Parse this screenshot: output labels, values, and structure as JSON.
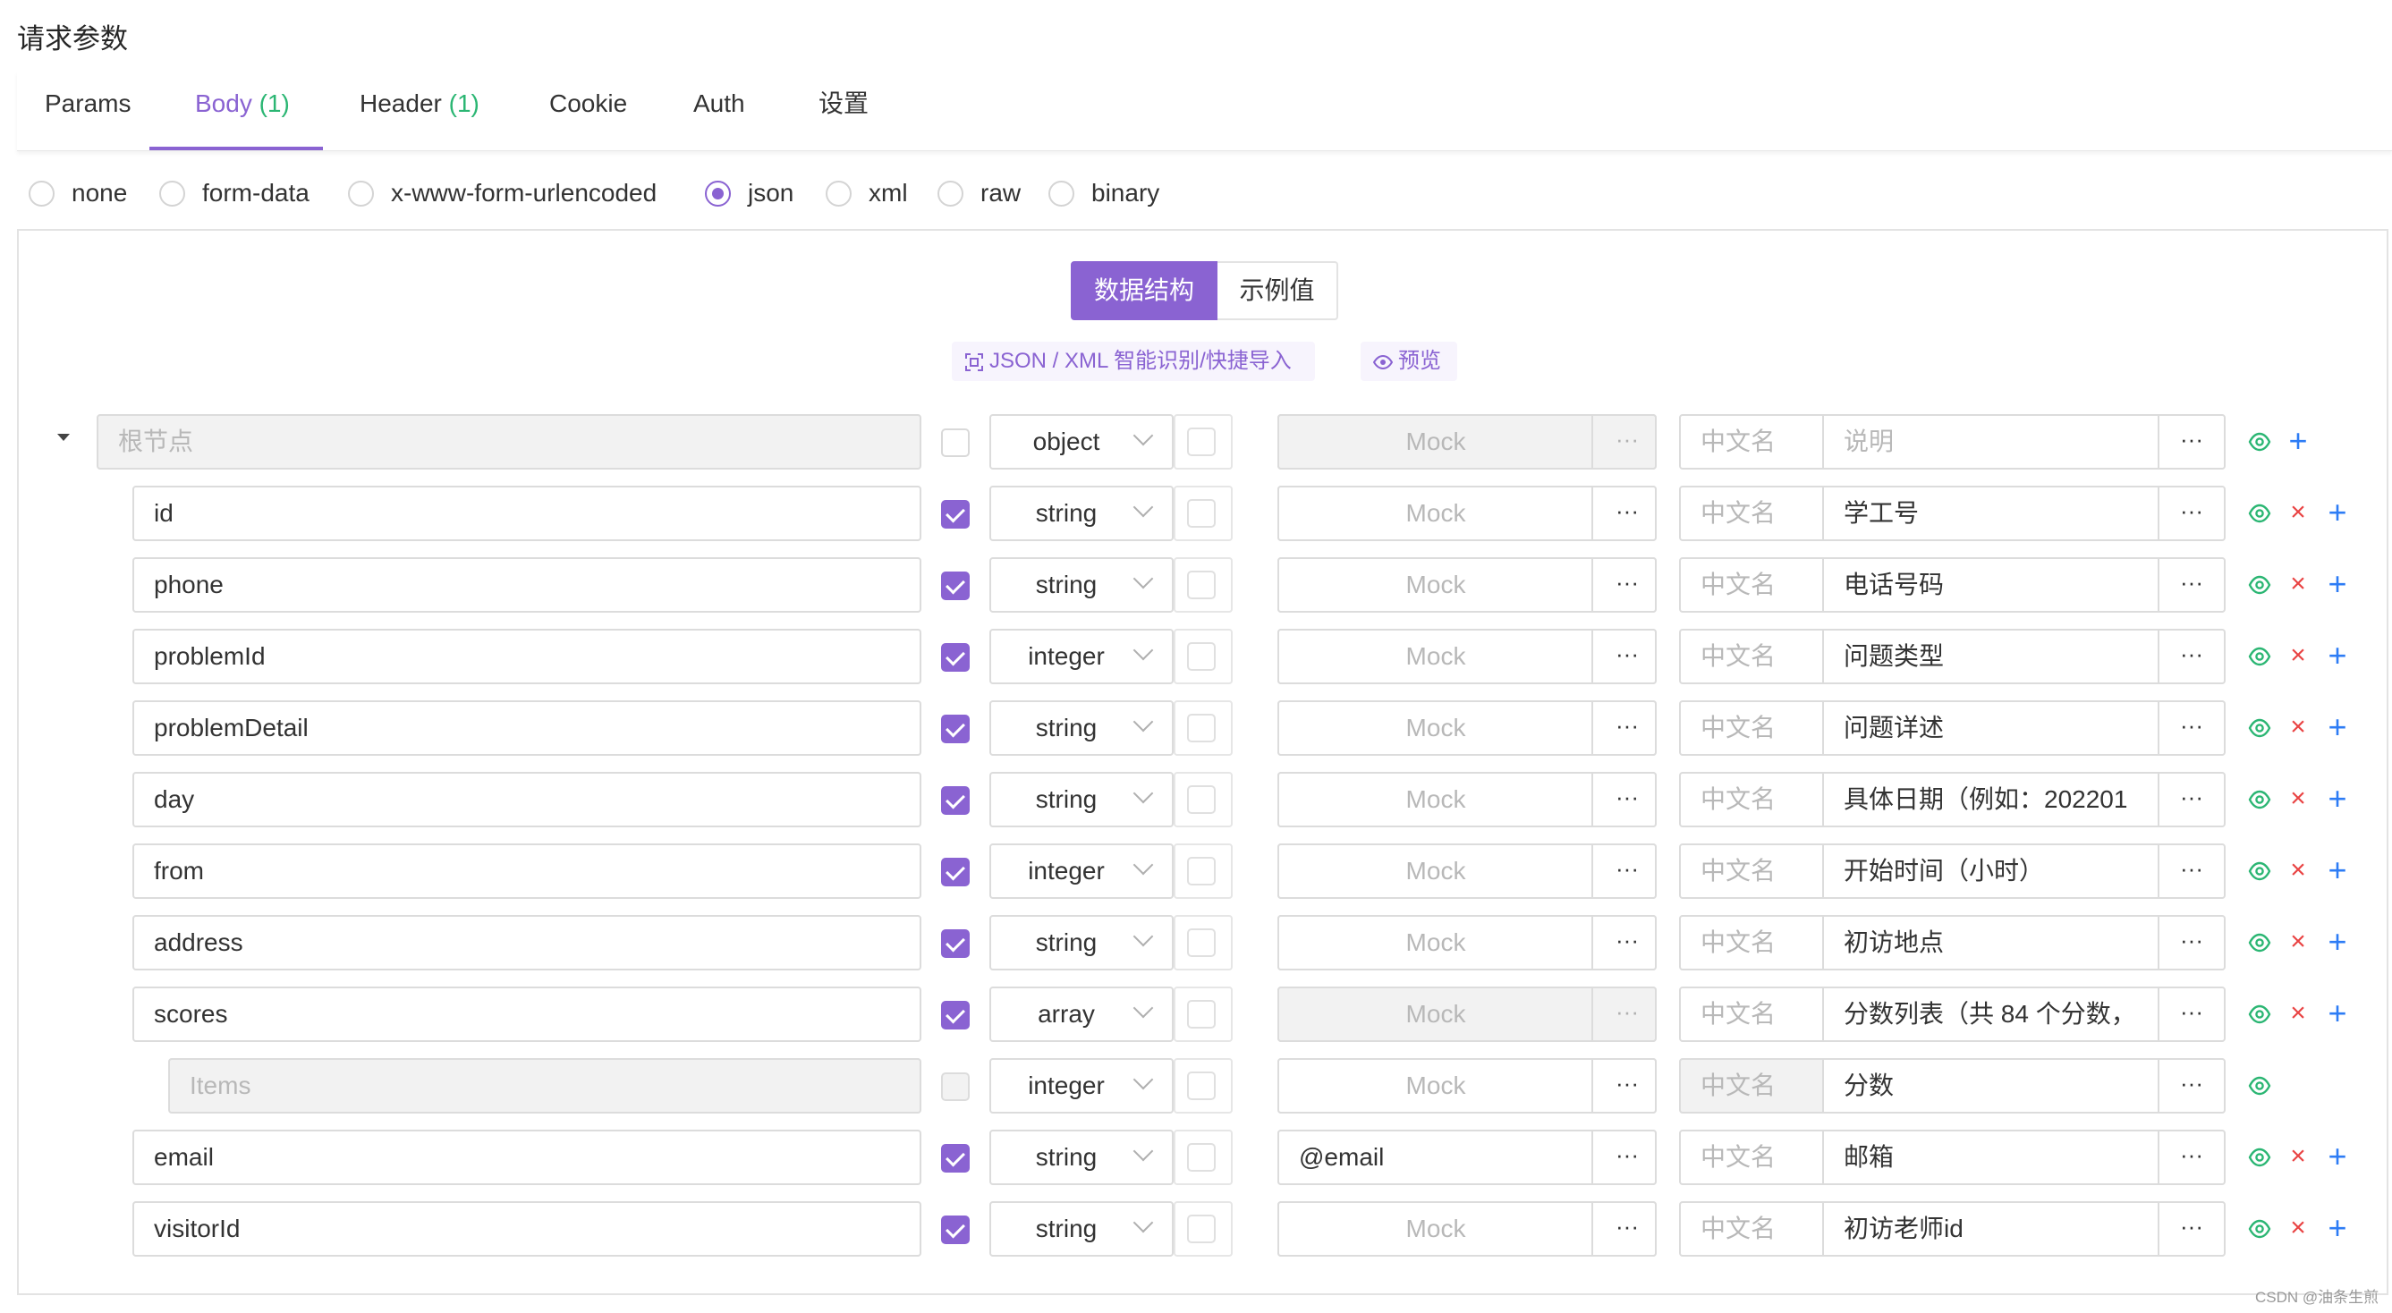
{
  "page": {
    "title": "请求参数"
  },
  "tabs": [
    {
      "label": "Params",
      "count": ""
    },
    {
      "label": "Body",
      "count": "(1)"
    },
    {
      "label": "Header",
      "count": "(1)"
    },
    {
      "label": "Cookie",
      "count": ""
    },
    {
      "label": "Auth",
      "count": ""
    },
    {
      "label": "设置",
      "count": ""
    }
  ],
  "active_tab": "Body",
  "body_types": [
    "none",
    "form-data",
    "x-www-form-urlencoded",
    "json",
    "xml",
    "raw",
    "binary"
  ],
  "selected_body_type": "json",
  "toggle": {
    "structure": "数据结构",
    "example": "示例值"
  },
  "actions": {
    "import": "JSON / XML 智能识别/快捷导入",
    "preview": "预览"
  },
  "placeholders": {
    "mock": "Mock",
    "cn_name": "中文名",
    "desc": "说明"
  },
  "colors": {
    "accent": "#8a63d2",
    "count": "#2bb673",
    "delete": "#e94343",
    "add": "#2d7cf5",
    "eye": "#2bb673"
  },
  "rows": [
    {
      "name": "根节点",
      "name_placeholder": true,
      "required": false,
      "type": "object",
      "mock": "",
      "cn": "",
      "desc": "说明",
      "desc_placeholder": true
    },
    {
      "name": "id",
      "required": true,
      "type": "string",
      "mock": "",
      "cn": "",
      "desc": "学工号"
    },
    {
      "name": "phone",
      "required": true,
      "type": "string",
      "mock": "",
      "cn": "",
      "desc": "电话号码"
    },
    {
      "name": "problemId",
      "required": true,
      "type": "integer",
      "mock": "",
      "cn": "",
      "desc": "问题类型"
    },
    {
      "name": "problemDetail",
      "required": true,
      "type": "string",
      "mock": "",
      "cn": "",
      "desc": "问题详述"
    },
    {
      "name": "day",
      "required": true,
      "type": "string",
      "mock": "",
      "cn": "",
      "desc": "具体日期（例如：202201"
    },
    {
      "name": "from",
      "required": true,
      "type": "integer",
      "mock": "",
      "cn": "",
      "desc": "开始时间（小时）"
    },
    {
      "name": "address",
      "required": true,
      "type": "string",
      "mock": "",
      "cn": "",
      "desc": "初访地点"
    },
    {
      "name": "scores",
      "required": true,
      "type": "array",
      "mock": "",
      "cn": "",
      "desc": "分数列表（共 84 个分数，"
    },
    {
      "name": "Items",
      "name_placeholder": true,
      "required": false,
      "type": "integer",
      "mock": "",
      "cn": "",
      "desc": "分数"
    },
    {
      "name": "email",
      "required": true,
      "type": "string",
      "mock": "@email",
      "cn": "",
      "desc": "邮箱"
    },
    {
      "name": "visitorId",
      "required": true,
      "type": "string",
      "mock": "",
      "cn": "",
      "desc": "初访老师id"
    }
  ],
  "watermark": "CSDN @油条生煎"
}
